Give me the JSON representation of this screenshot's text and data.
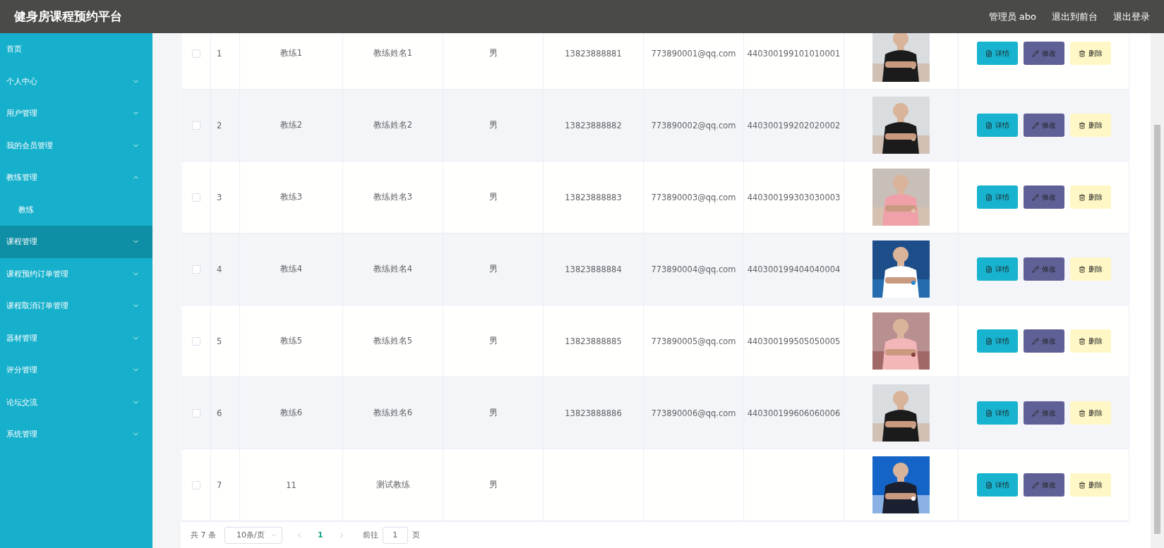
{
  "header": {
    "title": "健身房课程预约平台",
    "links": [
      "管理员 abo",
      "退出到前台",
      "退出登录"
    ]
  },
  "sidebar": {
    "items": [
      {
        "label": "首页",
        "selected": false
      },
      {
        "label": "个人中心",
        "selected": false,
        "expanded": false
      },
      {
        "label": "用户管理",
        "selected": false,
        "expanded": false
      },
      {
        "label": "我的会员管理",
        "selected": false,
        "expanded": false
      },
      {
        "label": "教练管理",
        "selected": false,
        "expanded": true,
        "children": [
          {
            "label": "教练",
            "selected": false
          }
        ]
      },
      {
        "label": "课程管理",
        "selected": true,
        "expanded": false
      },
      {
        "label": "课程预约订单管理",
        "selected": false,
        "expanded": false
      },
      {
        "label": "课程取消订单管理",
        "selected": false,
        "expanded": false
      },
      {
        "label": "器材管理",
        "selected": false,
        "expanded": false
      },
      {
        "label": "评分管理",
        "selected": false,
        "expanded": false
      },
      {
        "label": "论坛交流",
        "selected": false,
        "expanded": false
      },
      {
        "label": "系统管理",
        "selected": false,
        "expanded": false
      }
    ]
  },
  "table": {
    "rows": [
      {
        "checked": false,
        "index": "1",
        "account": "教练1",
        "name": "教练姓名1",
        "gender": "男",
        "phone": "13823888881",
        "email": "773890001@qq.com",
        "id_number": "440300199101010001",
        "actions": [
          {
            "kind": "detail",
            "label": "详情"
          },
          {
            "kind": "edit",
            "label": "修改"
          },
          {
            "kind": "delete",
            "label": "删除"
          }
        ]
      },
      {
        "checked": false,
        "index": "2",
        "account": "教练2",
        "name": "教练姓名2",
        "gender": "男",
        "phone": "13823888882",
        "email": "773890002@qq.com",
        "id_number": "440300199202020002",
        "actions": [
          {
            "kind": "detail",
            "label": "详情"
          },
          {
            "kind": "edit",
            "label": "修改"
          },
          {
            "kind": "delete",
            "label": "删除"
          }
        ]
      },
      {
        "checked": false,
        "index": "3",
        "account": "教练3",
        "name": "教练姓名3",
        "gender": "男",
        "phone": "13823888883",
        "email": "773890003@qq.com",
        "id_number": "440300199303030003",
        "actions": [
          {
            "kind": "detail",
            "label": "详情"
          },
          {
            "kind": "edit",
            "label": "修改"
          },
          {
            "kind": "delete",
            "label": "删除"
          }
        ]
      },
      {
        "checked": false,
        "index": "4",
        "account": "教练4",
        "name": "教练姓名4",
        "gender": "男",
        "phone": "13823888884",
        "email": "773890004@qq.com",
        "id_number": "440300199404040004",
        "actions": [
          {
            "kind": "detail",
            "label": "详情"
          },
          {
            "kind": "edit",
            "label": "修改"
          },
          {
            "kind": "delete",
            "label": "删除"
          }
        ]
      },
      {
        "checked": false,
        "index": "5",
        "account": "教练5",
        "name": "教练姓名5",
        "gender": "男",
        "phone": "13823888885",
        "email": "773890005@qq.com",
        "id_number": "440300199505050005",
        "actions": [
          {
            "kind": "detail",
            "label": "详情"
          },
          {
            "kind": "edit",
            "label": "修改"
          },
          {
            "kind": "delete",
            "label": "删除"
          }
        ]
      },
      {
        "checked": false,
        "index": "6",
        "account": "教练6",
        "name": "教练姓名6",
        "gender": "男",
        "phone": "13823888886",
        "email": "773890006@qq.com",
        "id_number": "440300199606060006",
        "actions": [
          {
            "kind": "detail",
            "label": "详情"
          },
          {
            "kind": "edit",
            "label": "修改"
          },
          {
            "kind": "delete",
            "label": "删除"
          }
        ]
      },
      {
        "checked": false,
        "index": "7",
        "account": "11",
        "name": "测试教练",
        "gender": "男",
        "actions": [
          {
            "kind": "detail",
            "label": "详情"
          },
          {
            "kind": "edit",
            "label": "修改"
          },
          {
            "kind": "delete",
            "label": "删除"
          }
        ]
      }
    ]
  },
  "pagination": {
    "total": "共 7 条",
    "page_size": "10条/页",
    "pages": [
      {
        "label": "1",
        "selected": true
      }
    ],
    "goto_label": "前往",
    "goto_value": "1",
    "goto_suffix": "页"
  }
}
